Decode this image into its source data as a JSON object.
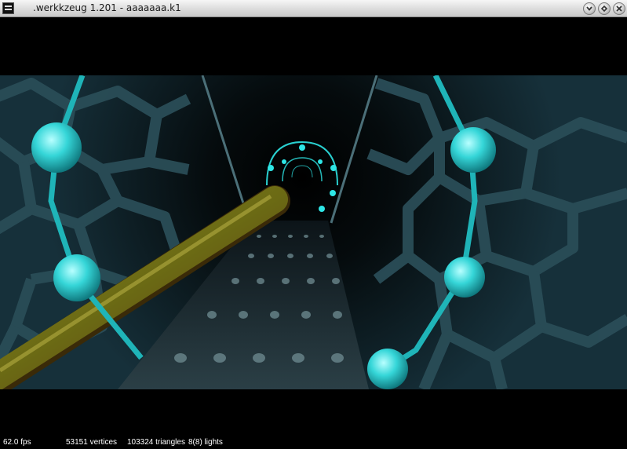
{
  "window": {
    "title": ".werkkzeug 1.201 - aaaaaaa.k1",
    "icon": "app-window-icon",
    "buttons": [
      {
        "name": "minimize-button",
        "icon": "chevron-down-icon"
      },
      {
        "name": "maximize-button",
        "icon": "restore-icon"
      },
      {
        "name": "close-button",
        "icon": "close-icon"
      }
    ]
  },
  "viewport": {
    "scene": "3d-preview-tunnel",
    "colors": {
      "glow": "#2ee6e6",
      "rock": "#1b3a44",
      "floor": "#23343a",
      "pipe": "#7a7418"
    }
  },
  "status": {
    "fps": "62.0 fps",
    "vertices": "53151 vertices",
    "triangles": "103324 triangles",
    "lights": "8(8) lights"
  }
}
